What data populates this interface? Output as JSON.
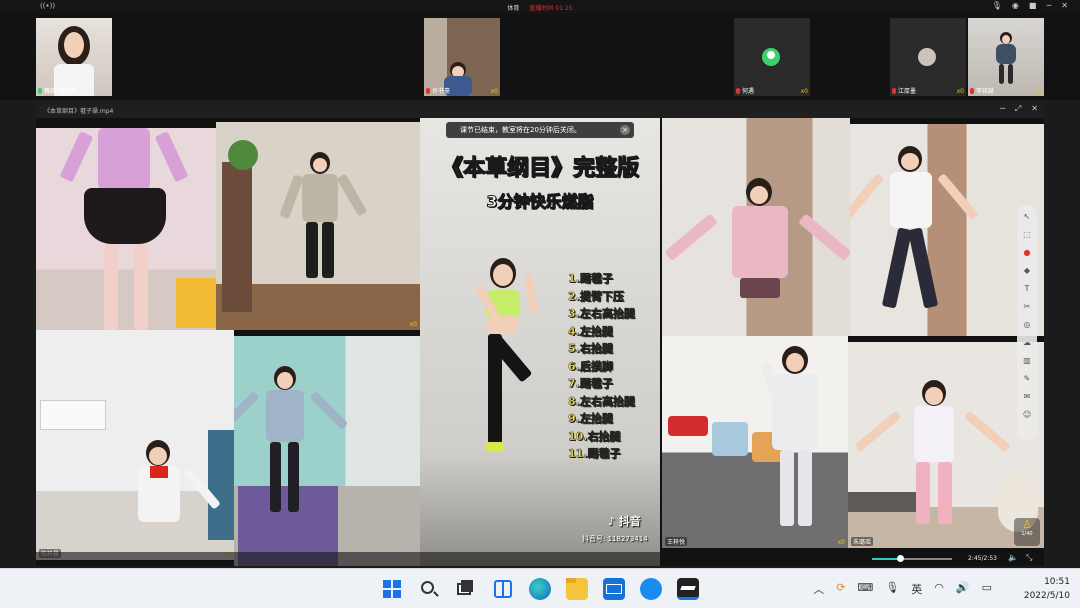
{
  "topbar": {
    "course": "体育",
    "recording_label": "直播时间 01:25"
  },
  "participants": [
    {
      "name": "舞蹈-刘老师",
      "trophies": ""
    },
    {
      "name": "许书豪",
      "trophies": "x0"
    },
    {
      "name": "何遇",
      "trophies": "x0"
    },
    {
      "name": "江厚墨",
      "trophies": "x0"
    },
    {
      "name": "李铭赫",
      "trophies": "x0"
    }
  ],
  "video_window": {
    "title": "《本草纲目》毽子操.mp4"
  },
  "banner": {
    "text": "课节已结束，教室将在20分钟后关闭。",
    "close": "×"
  },
  "video": {
    "title_line1": "《本草纲目》完整版",
    "title_line2": "3分钟快乐燃脂",
    "moves": [
      "1.踢毽子",
      "2.提臂下压",
      "3.左右高抬腿",
      "4.左抬腿",
      "5.右抬腿",
      "6.后摸脚",
      "7.踢毽子",
      "8.左右高抬腿",
      "9.左抬腿",
      "10.右抬腿",
      "11.踢毽子"
    ],
    "brand": "抖音",
    "account": "抖音号: 118273414",
    "time": "2:45/2:53",
    "progress_fraction": 0.35
  },
  "cells": [
    {
      "name": ""
    },
    {
      "name": "",
      "badge": "x0"
    },
    {
      "name": ""
    },
    {
      "name": ""
    },
    {
      "name": "陈梓晨",
      "badge": "x0"
    },
    {
      "name": "",
      "badge": "x0"
    },
    {
      "name": "王梓悦",
      "badge": "x0"
    },
    {
      "name": "朱璐瑶",
      "badge": "x0"
    }
  ],
  "page_badge": "1/40",
  "clock": {
    "time": "10:51",
    "date": "2022/5/10"
  },
  "tray": {
    "ime": "英"
  },
  "colors": {
    "accent": "#2fc9b8",
    "recording": "#e0312f",
    "trophy": "#f5c400",
    "moves_text": "#f3e24a"
  }
}
